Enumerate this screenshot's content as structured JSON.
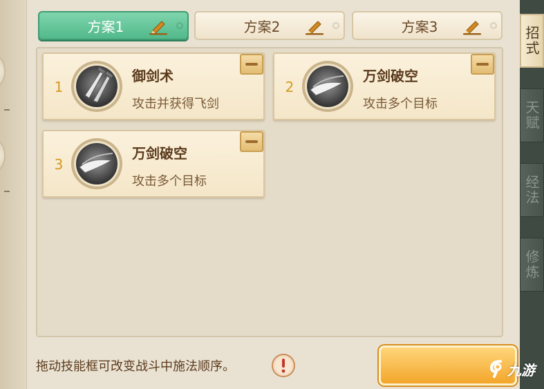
{
  "tabs": [
    {
      "label": "方案1",
      "active": true
    },
    {
      "label": "方案2",
      "active": false
    },
    {
      "label": "方案3",
      "active": false
    }
  ],
  "skills": [
    {
      "index": "1",
      "name": "御剑术",
      "desc": "攻击并获得飞剑",
      "icon": "twin-swords-icon"
    },
    {
      "index": "2",
      "name": "万剑破空",
      "desc": "攻击多个目标",
      "icon": "sword-slash-icon"
    },
    {
      "index": "3",
      "name": "万剑破空",
      "desc": "攻击多个目标",
      "icon": "sword-slash-icon"
    }
  ],
  "hint": "拖动技能框可改变战斗中施法顺序。",
  "side_tabs": [
    {
      "label": "招式",
      "active": true
    },
    {
      "label": "天赋",
      "active": false
    },
    {
      "label": "经法",
      "active": false
    },
    {
      "label": "修炼",
      "active": false
    }
  ],
  "watermark": "九游",
  "colors": {
    "tab_active": "#52b98b",
    "card_bg": "#f4e6c8",
    "number": "#d39a20",
    "text_brown": "#5b3a1c",
    "confirm_orange": "#f3a62b"
  }
}
